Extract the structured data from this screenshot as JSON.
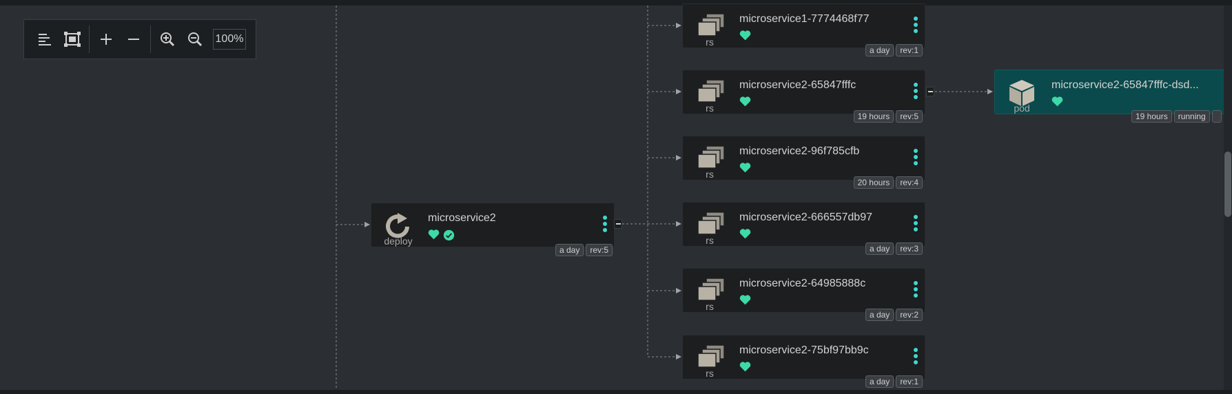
{
  "toolbar": {
    "icons": [
      "align-left-icon",
      "fit-screen-icon",
      "plus-icon",
      "minus-icon",
      "zoom-in-icon",
      "zoom-out-icon"
    ],
    "zoom": "100%"
  },
  "deploy": {
    "name": "microservice2",
    "kind": "deploy",
    "age": "a day",
    "rev": "rev:5"
  },
  "replicasets": [
    {
      "name": "microservice1-7774468f77",
      "kind": "rs",
      "age": "a day",
      "rev": "rev:1"
    },
    {
      "name": "microservice2-65847fffc",
      "kind": "rs",
      "age": "19 hours",
      "rev": "rev:5"
    },
    {
      "name": "microservice2-96f785cfb",
      "kind": "rs",
      "age": "20 hours",
      "rev": "rev:4"
    },
    {
      "name": "microservice2-666557db97",
      "kind": "rs",
      "age": "a day",
      "rev": "rev:3"
    },
    {
      "name": "microservice2-64985888c",
      "kind": "rs",
      "age": "a day",
      "rev": "rev:2"
    },
    {
      "name": "microservice2-75bf97bb9c",
      "kind": "rs",
      "age": "a day",
      "rev": "rev:1"
    }
  ],
  "pod": {
    "name": "microservice2-65847fffc-dsd...",
    "kind": "pod",
    "age": "19 hours",
    "status": "running"
  },
  "colors": {
    "background": "#2b2f33",
    "node": "#1c1e20",
    "pod": "#0b4a4c",
    "accent": "#3ed9d0",
    "healthy": "#3ed9a8"
  }
}
